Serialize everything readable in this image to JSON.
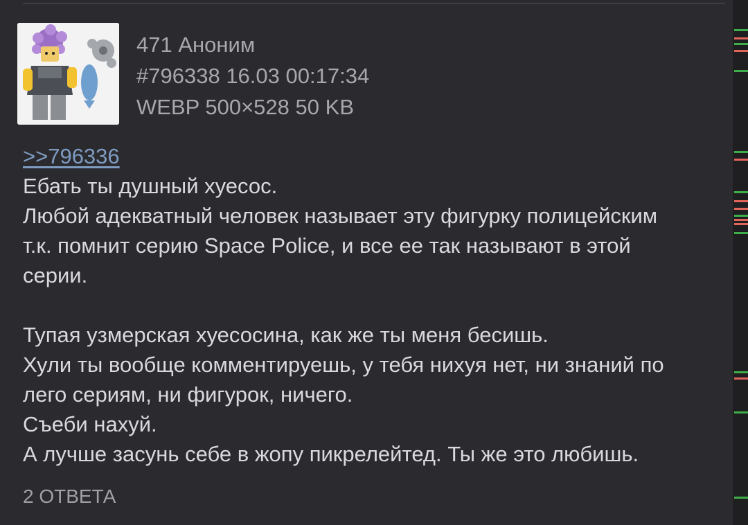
{
  "post": {
    "number": "471",
    "author": "Аноним",
    "post_id": "#796338",
    "date": "16.03",
    "time": "00:17:34",
    "file_format": "WEBP",
    "file_dimensions": "500×528",
    "file_size": "50 KB",
    "reply_link": ">>796336",
    "paragraph1": [
      "Ебать ты душный хуесос.",
      "Любой адекватный человек называет эту фигурку полицейским",
      "т.к. помнит серию Space Police, и все ее так называют в этой",
      "серии."
    ],
    "paragraph2": [
      "Тупая узмерская хуесосина, как же ты меня бесишь.",
      "Хули ты вообще комментируешь, у тебя нихуя нет, ни знаний по",
      "лего сериям, ни фигурок, ничего.",
      "Съеби нахуй.",
      "А лучше засунь себе в жопу пикрелейтед. Ты же это любишь."
    ],
    "replies_label": "2 ОТВЕТА"
  },
  "colors": {
    "background": "#2b2b2f",
    "text": "#d9d9de",
    "meta_text": "#a7a7ad",
    "link": "#7e9bc0",
    "scroll_mark_green": "#3fae4a",
    "scroll_mark_red": "#e0655a"
  }
}
